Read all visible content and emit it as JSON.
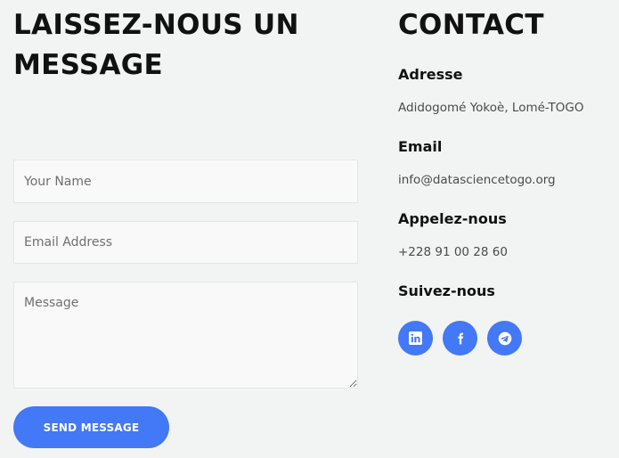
{
  "form": {
    "heading": "LAISSEZ-NOUS UN MESSAGE",
    "name_placeholder": "Your Name",
    "email_placeholder": "Email Address",
    "message_placeholder": "Message",
    "submit_label": "SEND MESSAGE"
  },
  "contact": {
    "heading": "CONTACT",
    "address_label": "Adresse",
    "address_value": "Adidogomé Yokoè, Lomé-TOGO",
    "email_label": "Email",
    "email_value": "info@datasciencetogo.org",
    "phone_label": "Appelez-nous",
    "phone_value": "+228 91 00 28 60",
    "social_label": "Suivez-nous",
    "socials": [
      {
        "icon": "linkedin-icon"
      },
      {
        "icon": "facebook-icon"
      },
      {
        "icon": "telegram-icon"
      }
    ]
  },
  "colors": {
    "accent": "#4378f6",
    "background": "#f2f4f3"
  }
}
